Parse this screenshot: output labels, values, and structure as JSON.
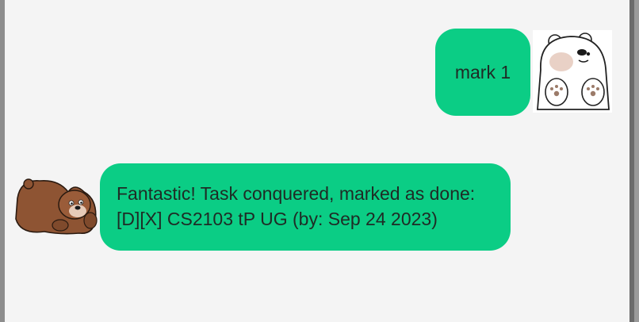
{
  "conversation": {
    "user_message": {
      "text": "mark 1",
      "avatar_icon": "polar-bear-avatar-icon"
    },
    "bot_message": {
      "line1": "Fantastic! Task conquered, marked as done:",
      "line2": "[D][X] CS2103 tP UG (by: Sep 24 2023)",
      "avatar_icon": "brown-bear-avatar-icon"
    }
  },
  "colors": {
    "bubble": "#0bcd85",
    "background": "#f4f4f4",
    "text": "#1f2b25"
  }
}
